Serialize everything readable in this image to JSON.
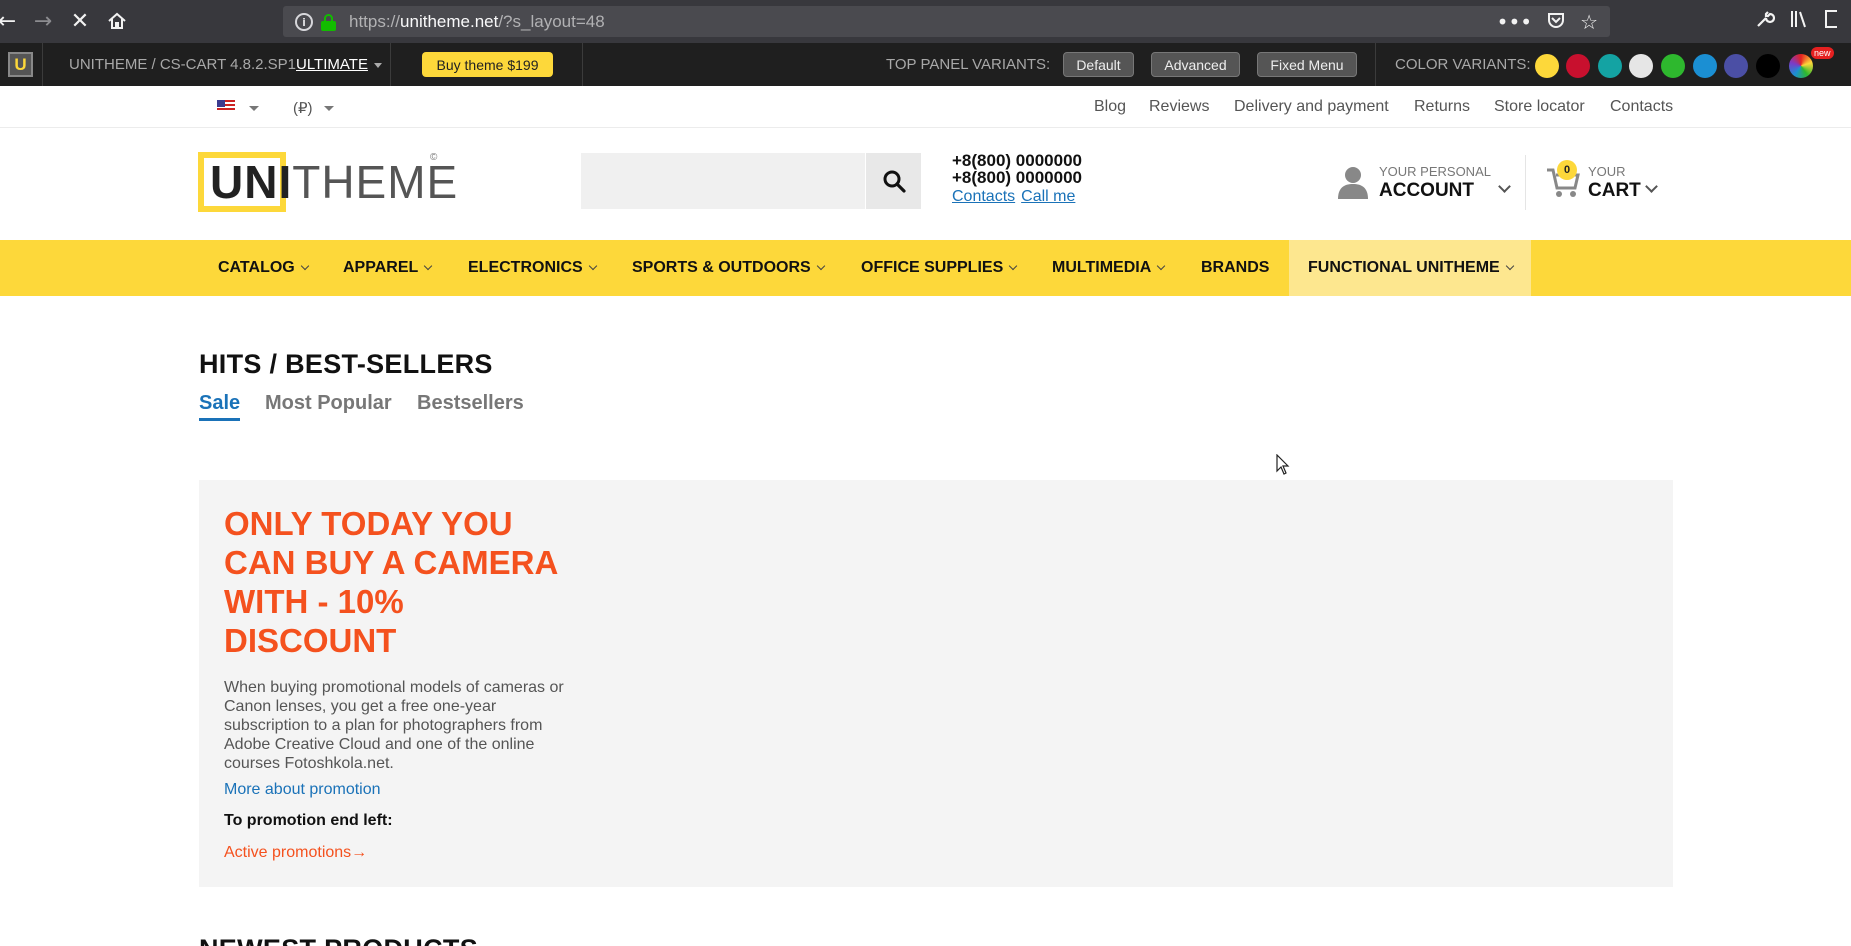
{
  "browser": {
    "url_prefix": "https://",
    "url_domain": "unitheme.net",
    "url_path": "/?s_layout=48"
  },
  "demo_panel": {
    "title": "UNITHEME / CS-CART 4.8.2.SP1",
    "edition": "ULTIMATE",
    "buy_label": "Buy theme $199",
    "top_panel_label": "TOP PANEL VARIANTS:",
    "variants": [
      "Default",
      "Advanced",
      "Fixed Menu"
    ],
    "color_label": "COLOR VARIANTS:",
    "colors": [
      "#fdd83a",
      "#c8102e",
      "#14a3a3",
      "#e6e6e6",
      "#2eb82e",
      "#1b8fd3",
      "#4b4fa5",
      "#000000"
    ],
    "new_badge": "new"
  },
  "top_links": {
    "currency": "(₽)",
    "links": [
      "Blog",
      "Reviews",
      "Delivery and payment",
      "Returns",
      "Store locator",
      "Contacts"
    ]
  },
  "header": {
    "logo_uni": "UNI",
    "logo_theme": "THEME",
    "logo_reg": "©",
    "search_placeholder": "",
    "phone1": "+8(800) 0000000",
    "phone2": "+8(800) 0000000",
    "contacts_link": "Contacts",
    "callme_link": "Call me",
    "account_sub": "YOUR PERSONAL",
    "account_main": "ACCOUNT",
    "cart_count": "0",
    "cart_sub": "YOUR",
    "cart_main": "CART"
  },
  "menu": {
    "items": [
      "CATALOG",
      "APPAREL",
      "ELECTRONICS",
      "SPORTS & OUTDOORS",
      "OFFICE SUPPLIES",
      "MULTIMEDIA",
      "BRANDS",
      "FUNCTIONAL UNITHEME"
    ]
  },
  "hits": {
    "title": "HITS / BEST-SELLERS",
    "tabs": [
      "Sale",
      "Most Popular",
      "Bestsellers"
    ]
  },
  "promo": {
    "heading": "ONLY TODAY YOU CAN BUY A CAMERA WITH - 10% DISCOUNT",
    "text": "When buying promotional models of cameras or Canon lenses, you get a free one-year subscription to a plan for photographers from Adobe Creative Cloud and one of the online courses Fotoshkola.net.",
    "more_link": "More about promotion",
    "end_label": "To promotion end left:",
    "active_link": "Active promotions→"
  },
  "newest": {
    "title": "NEWEST PRODUCTS"
  },
  "colors": {
    "accent_yellow": "#fdd83a",
    "link_blue": "#1a72b8",
    "promo_orange": "#f4511e"
  }
}
